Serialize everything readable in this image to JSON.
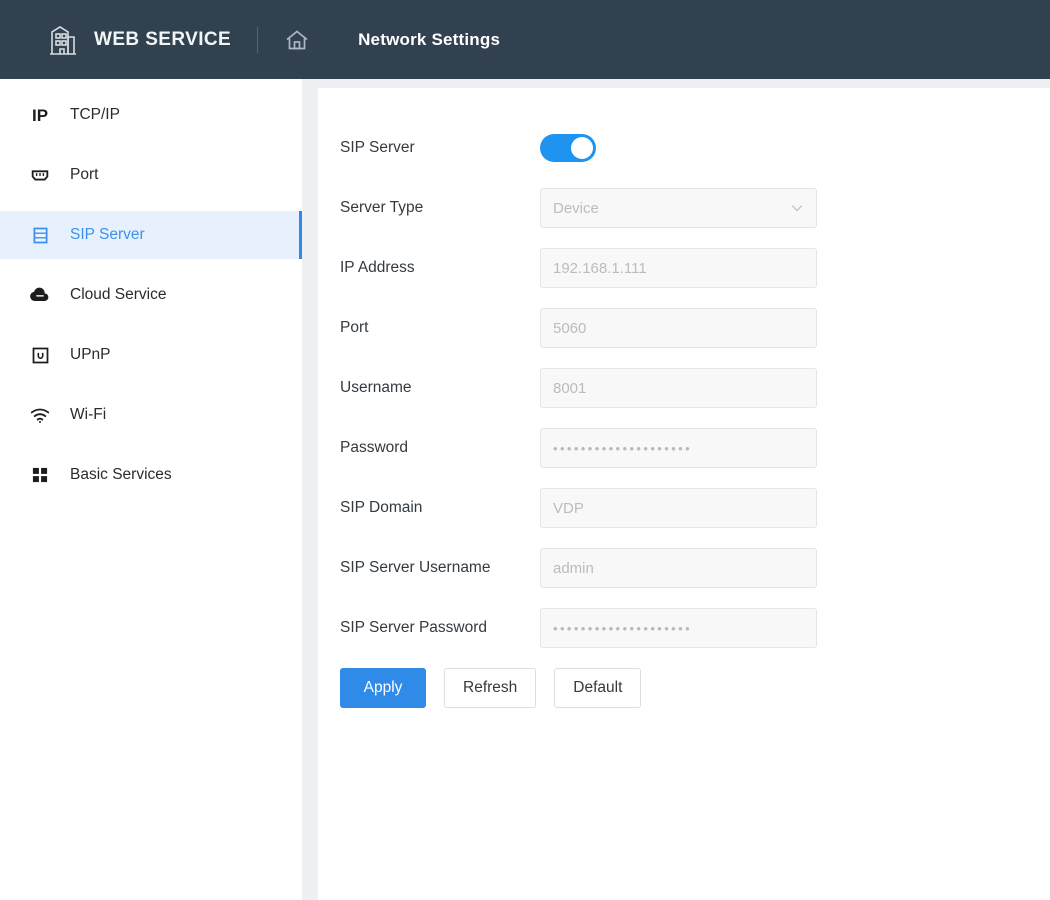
{
  "header": {
    "brand_icon": "building-icon",
    "brand_title": "WEB SERVICE",
    "home_icon": "home-icon",
    "page_title": "Network Settings"
  },
  "sidebar": {
    "items": [
      {
        "label": "TCP/IP",
        "icon": "ip-icon",
        "active": false
      },
      {
        "label": "Port",
        "icon": "ethernet-port-icon",
        "active": false
      },
      {
        "label": "SIP Server",
        "icon": "server-rack-icon",
        "active": true
      },
      {
        "label": "Cloud Service",
        "icon": "cloud-icon",
        "active": false
      },
      {
        "label": "UPnP",
        "icon": "upnp-icon",
        "active": false
      },
      {
        "label": "Wi-Fi",
        "icon": "wifi-icon",
        "active": false
      },
      {
        "label": "Basic Services",
        "icon": "grid-icon",
        "active": false
      }
    ]
  },
  "form": {
    "sip_server": {
      "label": "SIP Server",
      "toggle_on": true
    },
    "server_type": {
      "label": "Server Type",
      "value": "Device",
      "chevron_icon": "chevron-down-icon"
    },
    "ip_address": {
      "label": "IP Address",
      "value": "192.168.1.111"
    },
    "port": {
      "label": "Port",
      "value": "5060"
    },
    "username": {
      "label": "Username",
      "value": "8001"
    },
    "password": {
      "label": "Password",
      "value": "••••••••••••••••••••"
    },
    "sip_domain": {
      "label": "SIP Domain",
      "value": "VDP"
    },
    "sip_server_username": {
      "label": "SIP Server Username",
      "value": "admin"
    },
    "sip_server_password": {
      "label": "SIP Server Password",
      "value": "••••••••••••••••••••"
    },
    "buttons": {
      "apply": "Apply",
      "refresh": "Refresh",
      "default": "Default"
    }
  },
  "colors": {
    "header_bg": "#31414f",
    "accent": "#2f8ae8",
    "toggle_on": "#1f93f0",
    "active_nav_bg": "#e6f1fd",
    "panel_bg": "#eef0f4"
  }
}
